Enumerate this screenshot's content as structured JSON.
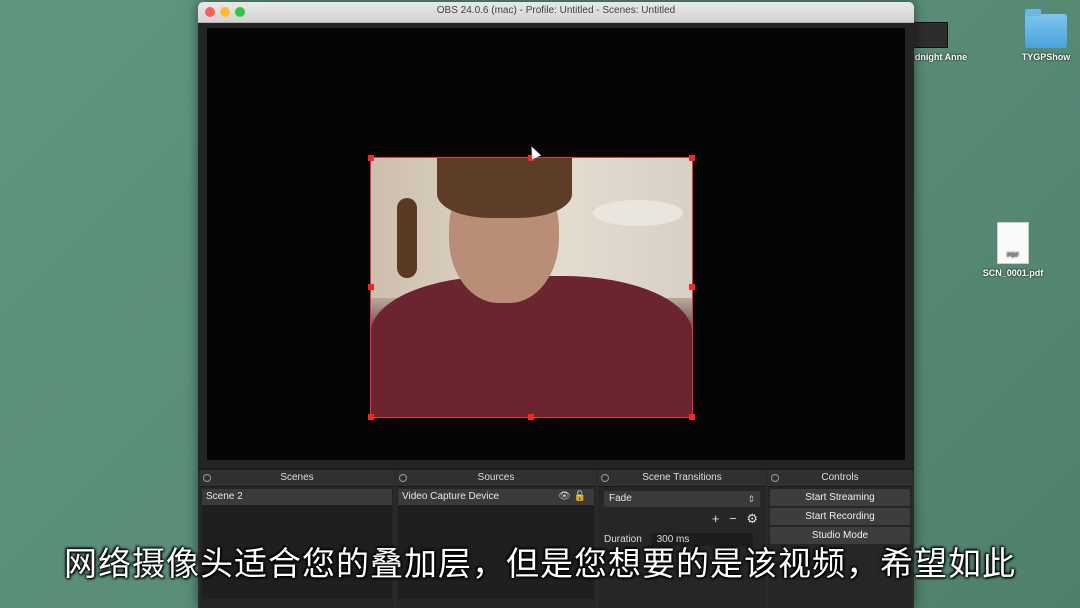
{
  "window": {
    "title": "OBS 24.0.6 (mac) - Profile: Untitled - Scenes: Untitled"
  },
  "desktop": {
    "icons": [
      {
        "label": "dnight Anne",
        "icon": "dark-thumbnail-icon"
      },
      {
        "label": "TYGPShow",
        "icon": "folder-icon"
      },
      {
        "label": "SCN_0001.pdf",
        "icon": "pdf-file-icon",
        "badge": "PDF"
      }
    ]
  },
  "docks": {
    "scenes": {
      "header": "Scenes",
      "items": [
        "Scene 2"
      ]
    },
    "sources": {
      "header": "Sources",
      "items": [
        "Video Capture Device"
      ]
    },
    "transitions": {
      "header": "Scene Transitions",
      "selected": "Fade",
      "duration_label": "Duration",
      "duration_value": "300 ms"
    },
    "controls": {
      "header": "Controls",
      "buttons": [
        "Start Streaming",
        "Start Recording",
        "Studio Mode"
      ]
    }
  },
  "subtitle": "网络摄像头适合您的叠加层，但是您想要的是该视频，希望如此",
  "colors": {
    "desktop": "#5a8f7a",
    "selection_handle": "#ff2222",
    "window_bg": "#1d1d1d"
  }
}
